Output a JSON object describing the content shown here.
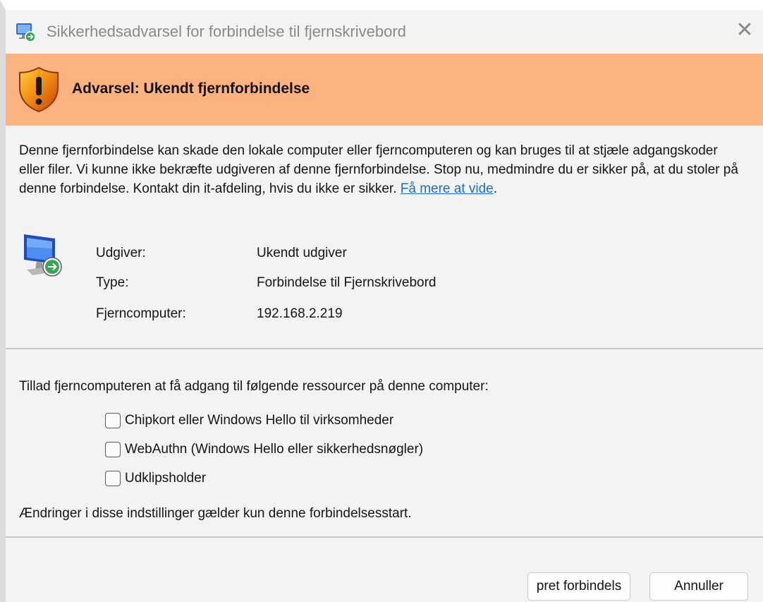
{
  "window": {
    "title": "Sikkerhedsadvarsel for forbindelse til fjernskrivebord",
    "close_symbol": "✕"
  },
  "banner": {
    "text": "Advarsel: Ukendt fjernforbindelse",
    "icon": "warning-shield-icon"
  },
  "description": {
    "text": "Denne fjernforbindelse kan skade den lokale computer eller fjerncomputeren og kan bruges til at stjæle adgangskoder eller filer. Vi kunne ikke bekræfte udgiveren af denne fjernforbindelse. Stop nu, medmindre du er sikker på, at du stoler på denne forbindelse. Kontakt din it-afdeling, hvis du ikke er sikker. ",
    "link": "Få mere at vide",
    "after_link": "."
  },
  "info": {
    "icon": "remote-desktop-computer-icon",
    "rows": [
      {
        "label": "Udgiver:",
        "value": "Ukendt udgiver"
      },
      {
        "label": "Type:",
        "value": "Forbindelse til Fjernskrivebord"
      },
      {
        "label": "Fjerncomputer:",
        "value": "192.168.2.219"
      }
    ]
  },
  "resources": {
    "title": "Tillad fjerncomputeren at få adgang til følgende ressourcer på denne computer:",
    "options": [
      {
        "label": "Chipkort eller Windows Hello til virksomheder",
        "checked": false
      },
      {
        "label": "WebAuthn (Windows Hello eller sikkerhedsnøgler)",
        "checked": false
      },
      {
        "label": "Udklipsholder",
        "checked": false
      }
    ],
    "note": "Ændringer i disse indstillinger gælder kun denne forbindelsesstart."
  },
  "buttons": {
    "connect": "pret forbindels",
    "cancel": "Annuller"
  },
  "colors": {
    "banner": "#fdb37f",
    "link": "#1a6fc8",
    "background": "#f3f3f3"
  }
}
